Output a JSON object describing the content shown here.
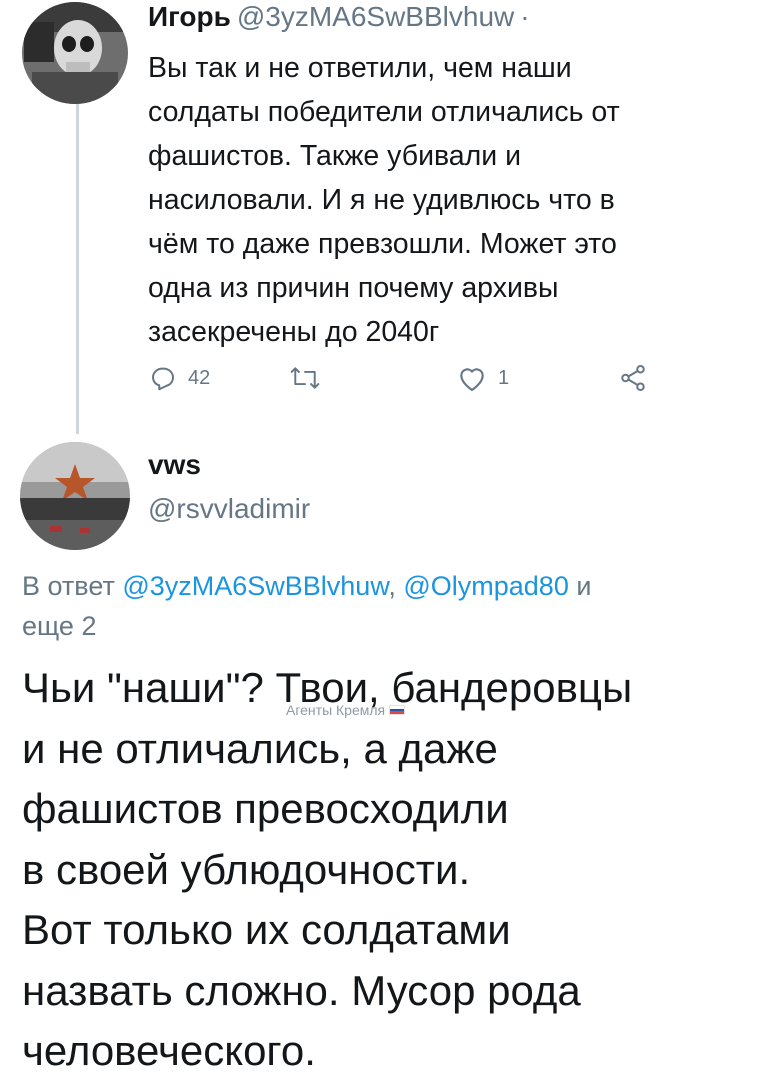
{
  "tweet1": {
    "name": "Игорь",
    "handle": "@3yzMA6SwBBlvhuw",
    "separator": "·",
    "text": "Вы так и не ответили, чем наши\nсолдаты победители отличались от\nфашистов. Также убивали и\nнасиловали. И я не удивлюсь что в\nчём то даже превзошли. Может это\nодна из причин почему архивы\nзасекречены до 2040г",
    "actions": {
      "reply_count": "42",
      "retweet_count": "",
      "like_count": "1"
    },
    "icons": {
      "reply": "reply-icon",
      "retweet": "retweet-icon",
      "like": "heart-icon",
      "share": "share-icon"
    }
  },
  "tweet2": {
    "name": "vws",
    "handle": "@rsvvladimir",
    "reply_prefix": "В ответ ",
    "reply_mention_1": "@3yzMA6SwBBlvhuw",
    "reply_sep": ", ",
    "reply_mention_2": "@Olympad80",
    "reply_suffix": " и\nеще 2",
    "text": "Чьи \"наши\"? Твои, бандеровцы\nи не отличались, а даже\nфашистов превосходили\nв своей ублюдочности.\nВот только их солдатами\nназвать сложно. Мусор рода\nчеловеческого."
  },
  "watermark": {
    "text": "Агенты Кремля"
  },
  "colors": {
    "link": "#1b95e0",
    "secondary": "#657786",
    "thread": "#ccd6dd",
    "text": "#14171a"
  }
}
